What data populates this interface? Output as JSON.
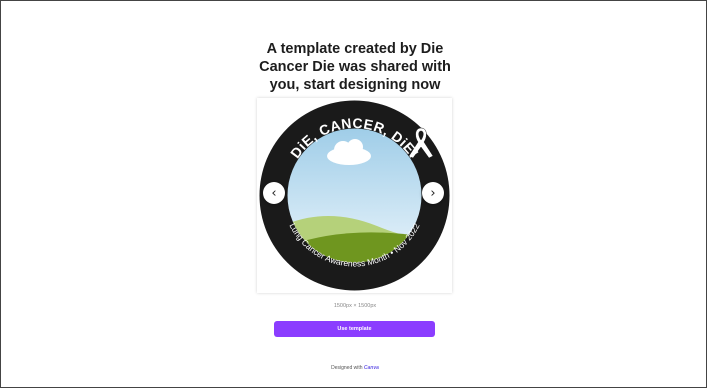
{
  "header": {
    "title_line1": "A template created by Die",
    "title_line2": "Cancer Die was shared with",
    "title_line3": "you, start designing now"
  },
  "preview": {
    "top_text": "DiE, CANCER, DiE!",
    "bottom_text": "Lung Cancer Awareness Month • Nov 2022",
    "prev_icon": "chevron-left-icon",
    "next_icon": "chevron-right-icon",
    "prev_glyph": "‹",
    "next_glyph": "›",
    "ribbon_icon": "awareness-ribbon-icon",
    "colors": {
      "ring": "#1a1a1a",
      "sky_top": "#9fcde8",
      "sky_bottom": "#e9f4fb",
      "hill_light": "#b5d17a",
      "hill_dark": "#6f961f"
    }
  },
  "dimensions": "1500px × 1500px",
  "actions": {
    "use_template_label": "Use template"
  },
  "footer": {
    "designed_with": "Designed with",
    "brand": "Canva",
    "brand_color": "#6c5ce7",
    "button_color": "#8b3dff"
  }
}
